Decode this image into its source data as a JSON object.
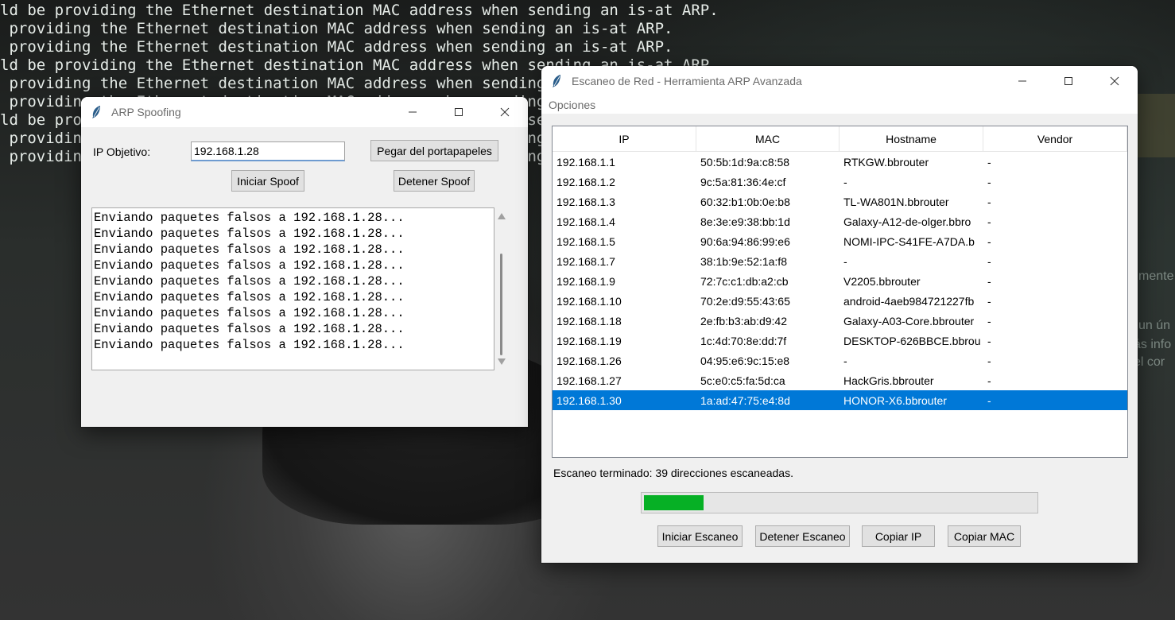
{
  "desktop": {
    "terminal_lines": [
      "ld be providing the Ethernet destination MAC address when sending an is-at ARP.",
      " providing the Ethernet destination MAC address when sending an is-at ARP.",
      " providing the Ethernet destination MAC address when sending an is-at ARP.",
      "ld be providing the Ethernet destination MAC address when sending an is-at ARP.",
      " providing the Ethernet destination MAC address when sending an is-at ARP.",
      " providing the Ethernet destination MAC address when sending an is-at ARP.",
      "ld be providing the Ethernet destination MAC address when sending an is-at ARP.",
      " providing the Ethernet destination MAC address when sending an is-at ARP.",
      " providing the Ethernet destination MAC address when sending an is-at ARP."
    ],
    "background_fragments": [
      "mente",
      "un ún",
      "ás info",
      "el cor"
    ]
  },
  "spoof_window": {
    "title": "ARP Spoofing",
    "target_label": "IP Objetivo:",
    "target_value": "192.168.1.28",
    "paste_button": "Pegar del portapapeles",
    "start_button": "Iniciar Spoof",
    "stop_button": "Detener Spoof",
    "log_lines": [
      "Enviando paquetes falsos a 192.168.1.28...",
      "Enviando paquetes falsos a 192.168.1.28...",
      "Enviando paquetes falsos a 192.168.1.28...",
      "Enviando paquetes falsos a 192.168.1.28...",
      "Enviando paquetes falsos a 192.168.1.28...",
      "Enviando paquetes falsos a 192.168.1.28...",
      "Enviando paquetes falsos a 192.168.1.28...",
      "Enviando paquetes falsos a 192.168.1.28...",
      "Enviando paquetes falsos a 192.168.1.28..."
    ]
  },
  "scanner_window": {
    "title": "Escaneo de Red - Herramienta ARP Avanzada",
    "menu": [
      "Opciones"
    ],
    "columns": [
      "IP",
      "MAC",
      "Hostname",
      "Vendor"
    ],
    "rows": [
      {
        "ip": "192.168.1.1",
        "mac": "50:5b:1d:9a:c8:58",
        "hostname": "RTKGW.bbrouter",
        "vendor": "-"
      },
      {
        "ip": "192.168.1.2",
        "mac": "9c:5a:81:36:4e:cf",
        "hostname": "-",
        "vendor": "-"
      },
      {
        "ip": "192.168.1.3",
        "mac": "60:32:b1:0b:0e:b8",
        "hostname": "TL-WA801N.bbrouter",
        "vendor": "-"
      },
      {
        "ip": "192.168.1.4",
        "mac": "8e:3e:e9:38:bb:1d",
        "hostname": "Galaxy-A12-de-olger.bbro",
        "vendor": "-"
      },
      {
        "ip": "192.168.1.5",
        "mac": "90:6a:94:86:99:e6",
        "hostname": "NOMI-IPC-S41FE-A7DA.b",
        "vendor": "-"
      },
      {
        "ip": "192.168.1.7",
        "mac": "38:1b:9e:52:1a:f8",
        "hostname": "-",
        "vendor": "-"
      },
      {
        "ip": "192.168.1.9",
        "mac": "72:7c:c1:db:a2:cb",
        "hostname": "V2205.bbrouter",
        "vendor": "-"
      },
      {
        "ip": "192.168.1.10",
        "mac": "70:2e:d9:55:43:65",
        "hostname": "android-4aeb984721227fb",
        "vendor": "-"
      },
      {
        "ip": "192.168.1.18",
        "mac": "2e:fb:b3:ab:d9:42",
        "hostname": "Galaxy-A03-Core.bbrouter",
        "vendor": "-"
      },
      {
        "ip": "192.168.1.19",
        "mac": "1c:4d:70:8e:dd:7f",
        "hostname": "DESKTOP-626BBCE.bbrou",
        "vendor": "-"
      },
      {
        "ip": "192.168.1.26",
        "mac": "04:95:e6:9c:15:e8",
        "hostname": "-",
        "vendor": "-"
      },
      {
        "ip": "192.168.1.27",
        "mac": "5c:e0:c5:fa:5d:ca",
        "hostname": "HackGris.bbrouter",
        "vendor": "-"
      },
      {
        "ip": "192.168.1.30",
        "mac": "1a:ad:47:75:e4:8d",
        "hostname": "HONOR-X6.bbrouter",
        "vendor": "-",
        "selected": true
      }
    ],
    "status": "Escaneo terminado: 39 direcciones escaneadas.",
    "progress_fraction": 0.15,
    "buttons": {
      "start": "Iniciar Escaneo",
      "stop": "Detener Escaneo",
      "copy_ip": "Copiar IP",
      "copy_mac": "Copiar MAC"
    }
  },
  "colors": {
    "selection": "#0078d7",
    "progress": "#06b025"
  }
}
